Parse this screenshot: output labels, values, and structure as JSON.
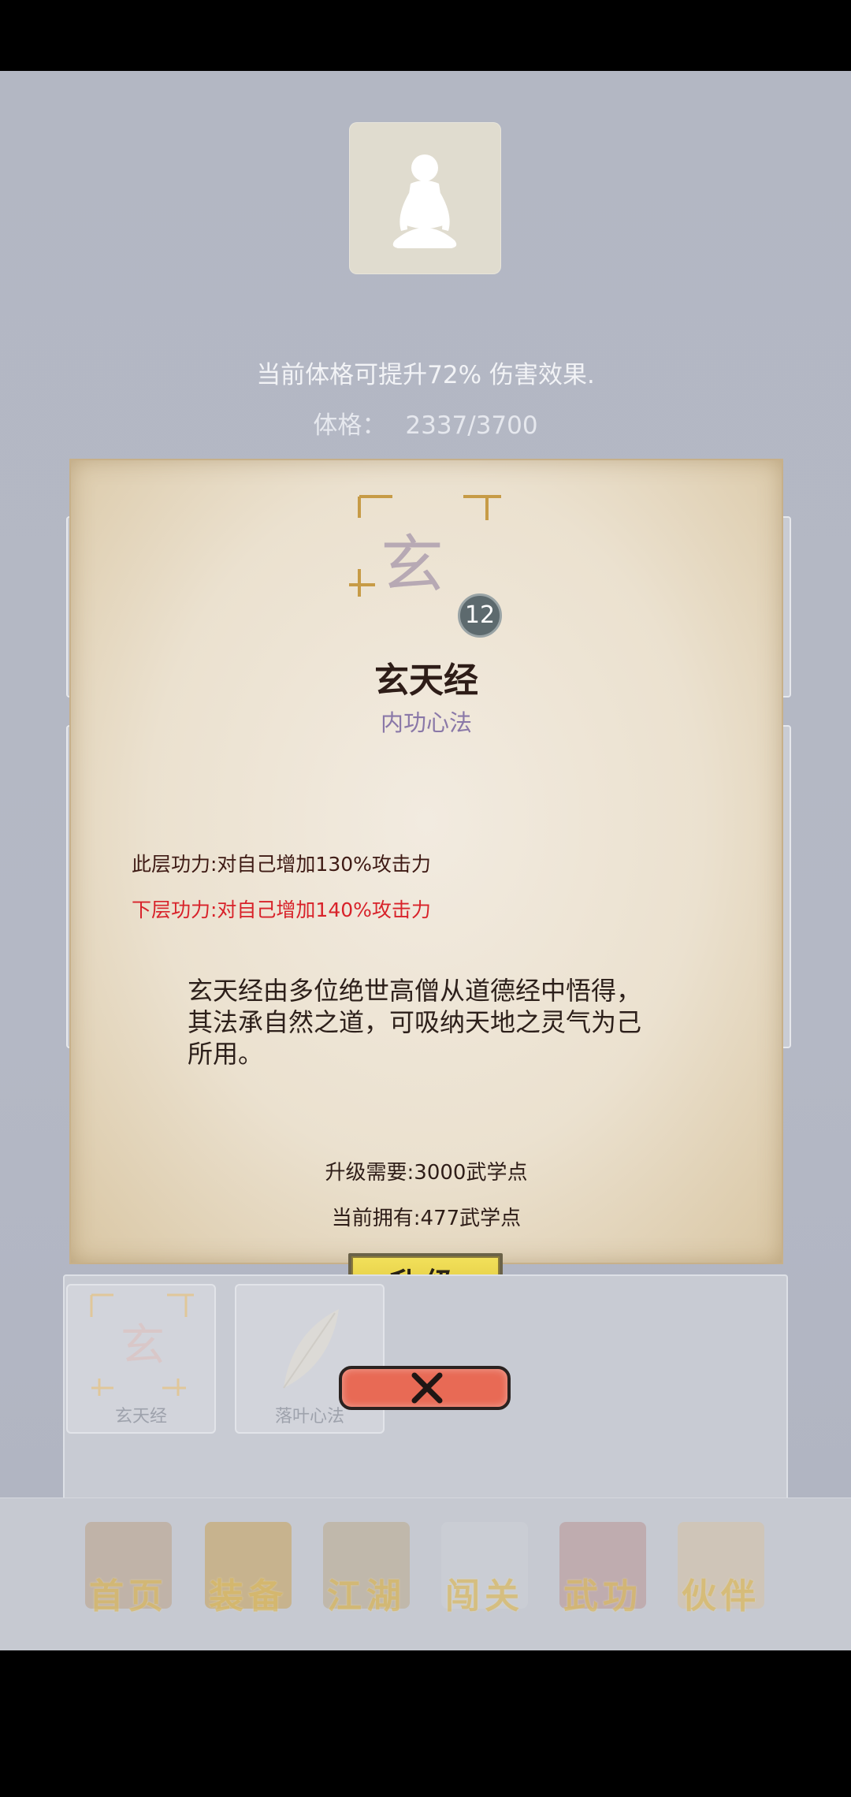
{
  "header": {
    "stat_effect": "当前体格可提升72% 伤害效果.",
    "stat_label": "体格：",
    "stat_value": "2337/3700"
  },
  "dialog": {
    "char": "玄",
    "level": "12",
    "title": "玄天经",
    "type": "内功心法",
    "current_effect": "此层功力:对自己增加130%攻击力",
    "next_effect": "下层功力:对自己增加140%攻击力",
    "description": "玄天经由多位绝世高僧从道德经中悟得，其法承自然之道，可吸纳天地之灵气为己所用。",
    "upgrade_cost": "升级需要:3000武学点",
    "current_points": "当前拥有:477武学点",
    "upgrade_label": "升级"
  },
  "skills": [
    {
      "name": "玄天经",
      "char": "玄"
    },
    {
      "name": "落叶心法",
      "char": ""
    }
  ],
  "nav": [
    {
      "label": "首页",
      "color": "#b79a76"
    },
    {
      "label": "装备",
      "color": "#c79a3c"
    },
    {
      "label": "江湖",
      "color": "#b9a47c"
    },
    {
      "label": "闯关",
      "color": "#cfd2d8"
    },
    {
      "label": "武功",
      "color": "#b58a86"
    },
    {
      "label": "伙伴",
      "color": "#d9c29a"
    }
  ],
  "colors": {
    "effect_next": "#d8222a",
    "skill_type": "#8a78a8",
    "upgrade_button": "#e8d04a",
    "close_button": "#e86a55"
  }
}
